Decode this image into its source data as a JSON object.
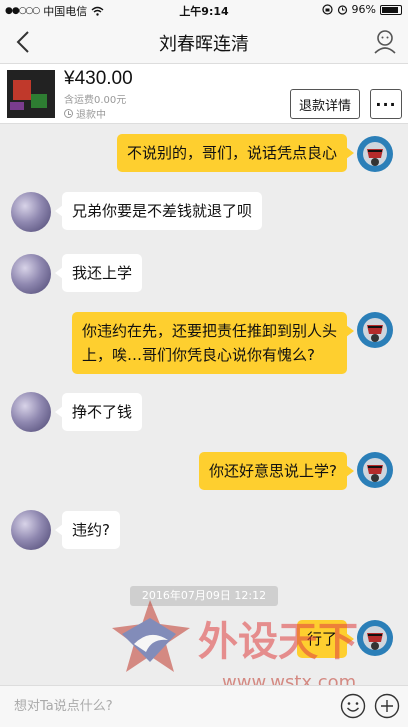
{
  "status_bar": {
    "signal": "●●○○○",
    "carrier": "中国电信",
    "time": "上午9:14",
    "battery": "96%"
  },
  "header": {
    "title": "刘春晖连清"
  },
  "product": {
    "price": "¥430.00",
    "shipping": "含运费0.00元",
    "status": "退款中",
    "refund_button": "退款详情"
  },
  "messages": [
    {
      "side": "me",
      "text": "不说别的，哥们，说话凭点良心"
    },
    {
      "side": "other",
      "text": "兄弟你要是不差钱就退了呗"
    },
    {
      "side": "other",
      "text": "我还上学"
    },
    {
      "side": "me",
      "line1": "你违约在先，还要把责任推卸到别人头",
      "line2": "上，唉…哥们你凭良心说你有愧么?"
    },
    {
      "side": "other",
      "text": "挣不了钱"
    },
    {
      "side": "me",
      "text": "你还好意思说上学?"
    },
    {
      "side": "other",
      "text": "违约?"
    },
    {
      "side": "me",
      "text": "行了"
    }
  ],
  "timestamp": "2016年07月09日 12:12",
  "watermark": {
    "cn": "外设天下",
    "url": "www.wstx.com"
  },
  "input": {
    "placeholder": "想对Ta说点什么?"
  }
}
